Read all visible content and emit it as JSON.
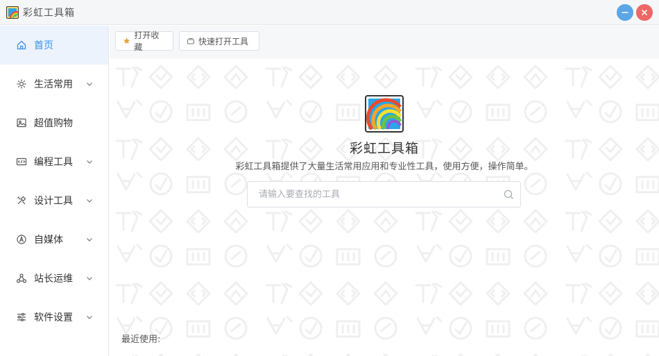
{
  "app": {
    "title": "彩虹工具箱"
  },
  "window": {
    "minimize_icon": "minus-icon",
    "close_icon": "close-icon"
  },
  "sidebar": {
    "items": [
      {
        "label": "首页",
        "icon": "home-icon",
        "active": true,
        "has_children": false
      },
      {
        "label": "生活常用",
        "icon": "sparkle-icon",
        "active": false,
        "has_children": true
      },
      {
        "label": "超值购物",
        "icon": "photo-icon",
        "active": false,
        "has_children": false
      },
      {
        "label": "编程工具",
        "icon": "code-icon",
        "active": false,
        "has_children": true
      },
      {
        "label": "设计工具",
        "icon": "tools-icon",
        "active": false,
        "has_children": true
      },
      {
        "label": "自媒体",
        "icon": "media-icon",
        "active": false,
        "has_children": true
      },
      {
        "label": "站长运维",
        "icon": "network-icon",
        "active": false,
        "has_children": true
      },
      {
        "label": "软件设置",
        "icon": "sliders-icon",
        "active": false,
        "has_children": true
      }
    ]
  },
  "toolbar": {
    "favorites_label": "打开收藏",
    "quick_open_label": "快速打开工具"
  },
  "hero": {
    "title": "彩虹工具箱",
    "subtitle": "彩虹工具箱提供了大量生活常用应用和专业性工具，使用方便，操作简单。"
  },
  "search": {
    "placeholder": "请输入要查找的工具",
    "value": ""
  },
  "recent": {
    "label": "最近使用:"
  },
  "colors": {
    "accent": "#3a8ee6",
    "active_bg": "#ecf3fd",
    "minimize": "#5aa6e6",
    "close": "#ee6666",
    "star": "#e6a23c"
  }
}
